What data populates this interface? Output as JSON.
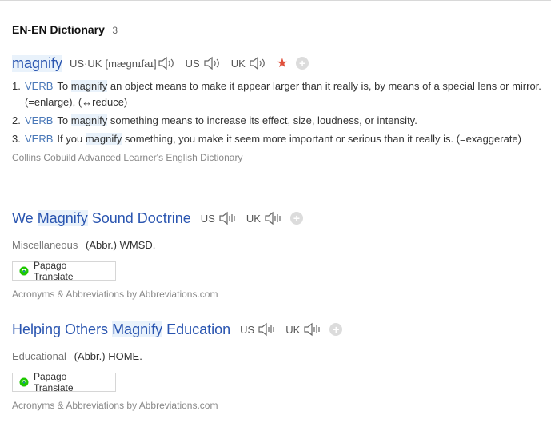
{
  "header": {
    "title": "EN-EN Dictionary",
    "count": "3"
  },
  "entry1": {
    "headword": "magnify",
    "pron_label": "US·UK",
    "ipa": "[mægnɪfaɪ]",
    "us_label": "US",
    "uk_label": "UK",
    "star": "★",
    "plus": "+",
    "defs": [
      {
        "num": "1.",
        "pos": "VERB",
        "pre": "To ",
        "hl": "magnify",
        "post": " an object means to make it appear larger than it really is, by means of a special lens or mirror. (=enlarge), (↔reduce)"
      },
      {
        "num": "2.",
        "pos": "VERB",
        "pre": "To ",
        "hl": "magnify",
        "post": " something means to increase its effect, size, loudness, or intensity."
      },
      {
        "num": "3.",
        "pos": "VERB",
        "pre": "If you ",
        "hl": "magnify",
        "post": " something, you make it seem more important or serious than it really is. (=exaggerate)"
      }
    ],
    "source": "Collins Cobuild Advanced Learner's English Dictionary"
  },
  "entry2": {
    "hw_pre": "We ",
    "hw_hl": "Magnify",
    "hw_post": " Sound Doctrine",
    "us_label": "US",
    "uk_label": "UK",
    "plus": "+",
    "category": "Miscellaneous",
    "abbr": "(Abbr.) WMSD.",
    "papago": "Papago Translate",
    "source": "Acronyms & Abbreviations by Abbreviations.com"
  },
  "entry3": {
    "hw_pre": "Helping Others ",
    "hw_hl": "Magnify",
    "hw_post": " Education",
    "us_label": "US",
    "uk_label": "UK",
    "plus": "+",
    "category": "Educational",
    "abbr": "(Abbr.) HOME.",
    "papago": "Papago Translate",
    "source": "Acronyms & Abbreviations by Abbreviations.com"
  }
}
